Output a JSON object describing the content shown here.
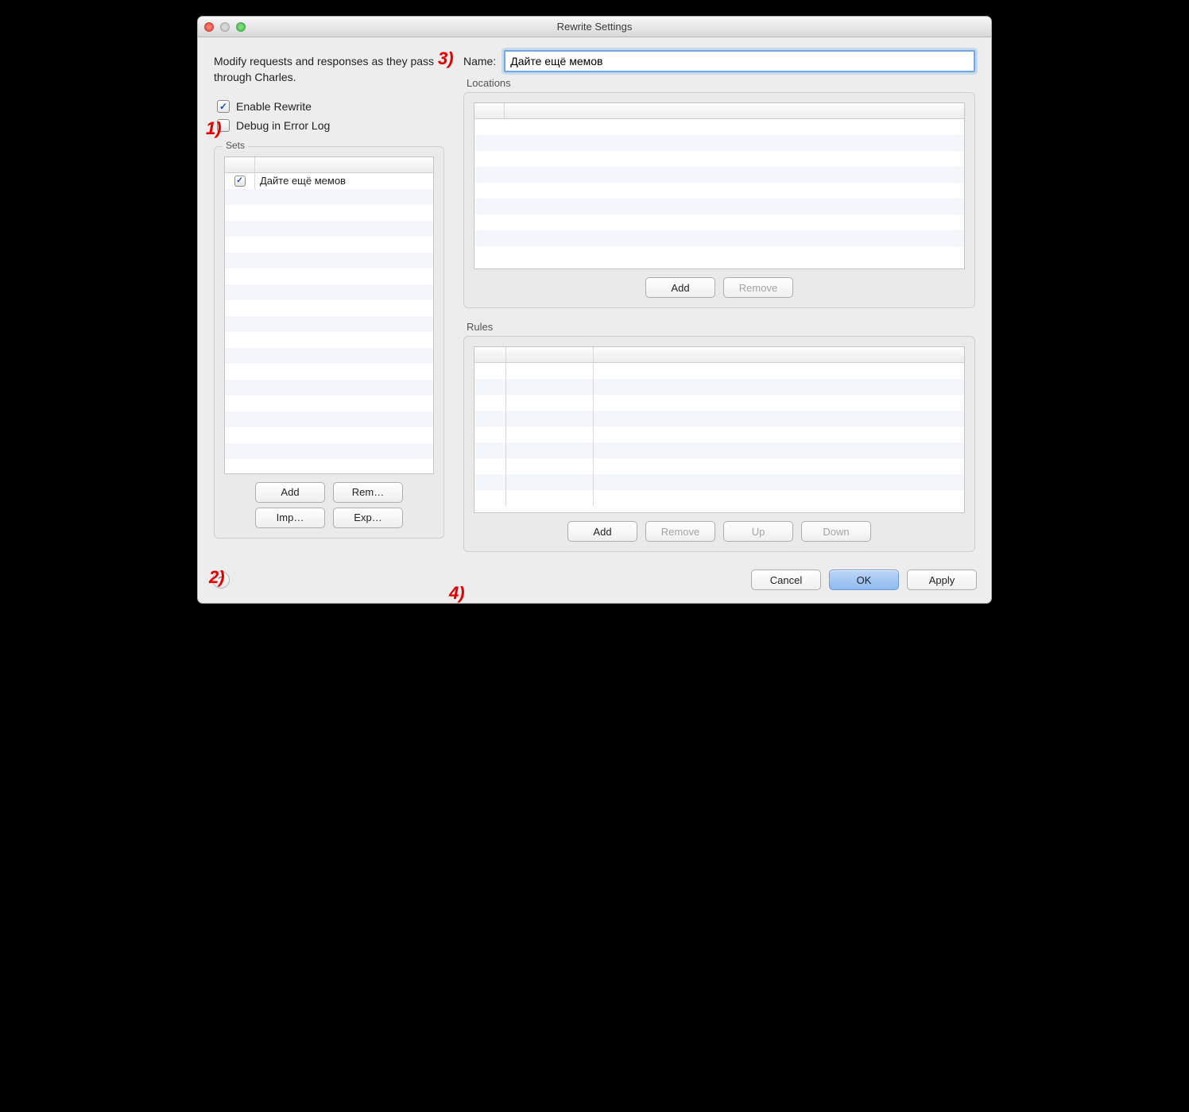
{
  "window": {
    "title": "Rewrite Settings"
  },
  "description": "Modify requests and responses as they pass through Charles.",
  "checkboxes": {
    "enable_rewrite": {
      "label": "Enable Rewrite",
      "checked": true
    },
    "debug_error_log": {
      "label": "Debug in Error Log",
      "checked": false
    }
  },
  "sets": {
    "label": "Sets",
    "items": [
      {
        "checked": true,
        "name": "Дайте ещё мемов"
      }
    ],
    "buttons": {
      "add": "Add",
      "remove": "Rem…",
      "import": "Imp…",
      "export": "Exp…"
    }
  },
  "right": {
    "name_label": "Name:",
    "name_value": "Дайте ещё мемов",
    "locations": {
      "label": "Locations",
      "buttons": {
        "add": "Add",
        "remove": "Remove"
      }
    },
    "rules": {
      "label": "Rules",
      "buttons": {
        "add": "Add",
        "remove": "Remove",
        "up": "Up",
        "down": "Down"
      }
    }
  },
  "footer": {
    "help": "?",
    "cancel": "Cancel",
    "ok": "OK",
    "apply": "Apply"
  },
  "annotations": {
    "a1": "1)",
    "a2": "2)",
    "a3": "3)",
    "a4": "4)"
  }
}
